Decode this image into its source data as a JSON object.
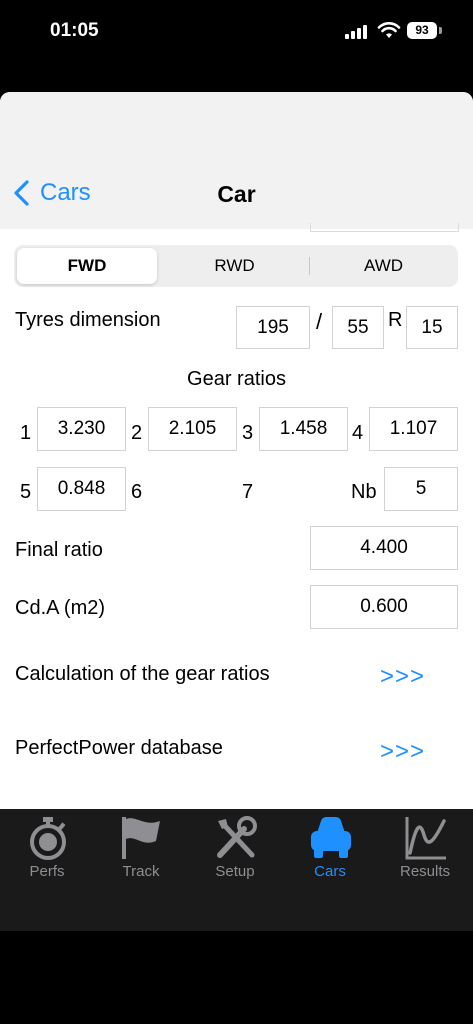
{
  "status_bar": {
    "time": "01:05",
    "battery": "93"
  },
  "nav": {
    "back_label": "Cars",
    "title": "Car"
  },
  "drive": {
    "options": [
      "FWD",
      "RWD",
      "AWD"
    ],
    "selected": "FWD"
  },
  "tyres": {
    "label": "Tyres dimension",
    "width": "195",
    "slash": "/",
    "aspect": "55",
    "r": "R",
    "rim": "15"
  },
  "gears": {
    "title": "Gear ratios",
    "items": [
      {
        "n": "1",
        "v": "3.230"
      },
      {
        "n": "2",
        "v": "2.105"
      },
      {
        "n": "3",
        "v": "1.458"
      },
      {
        "n": "4",
        "v": "1.107"
      },
      {
        "n": "5",
        "v": "0.848"
      },
      {
        "n": "6",
        "v": ""
      },
      {
        "n": "7",
        "v": ""
      }
    ],
    "nb_label": "Nb",
    "nb_value": "5"
  },
  "final_ratio": {
    "label": "Final ratio",
    "value": "4.400"
  },
  "cda": {
    "label": "Cd.A (m2)",
    "value": "0.600"
  },
  "links": [
    {
      "label": "Calculation of the gear ratios",
      "arrow": ">>>"
    },
    {
      "label": "PerfectPower database",
      "arrow": ">>>"
    }
  ],
  "tabs": [
    {
      "label": "Perfs",
      "icon": "stopwatch-icon"
    },
    {
      "label": "Track",
      "icon": "flag-icon"
    },
    {
      "label": "Setup",
      "icon": "tools-icon"
    },
    {
      "label": "Cars",
      "icon": "car-icon"
    },
    {
      "label": "Results",
      "icon": "chart-icon"
    }
  ],
  "active_tab": "Cars",
  "colors": {
    "accent": "#1e90ff",
    "tabbar_bg": "#1a1a1a",
    "inactive_tab": "#8e8e93"
  }
}
